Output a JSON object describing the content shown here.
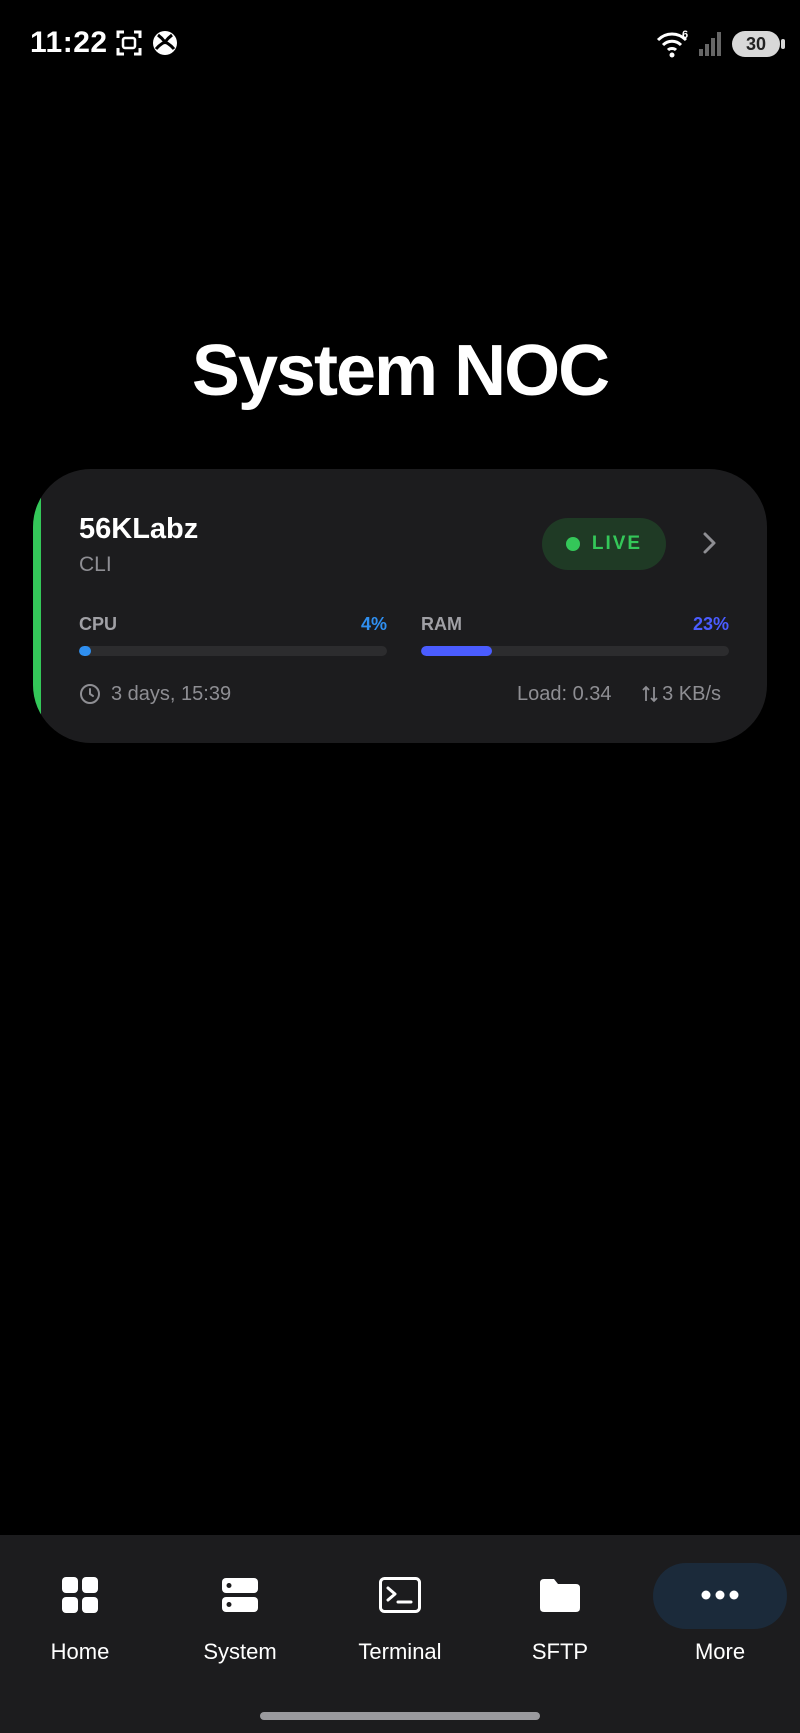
{
  "status_bar": {
    "time": "11:22",
    "wifi_badge": "6",
    "battery": "30",
    "icons": [
      "screenshot-icon",
      "xbox-icon",
      "wifi-icon",
      "signal-icon",
      "battery-icon"
    ]
  },
  "page": {
    "title": "System NOC"
  },
  "server": {
    "name": "56KLabz",
    "type": "CLI",
    "status": "LIVE",
    "status_color": "#34c759",
    "accent_color": "#34c759",
    "cpu": {
      "label": "CPU",
      "value_text": "4%",
      "percent": 4,
      "color": "#2f8ff0"
    },
    "ram": {
      "label": "RAM",
      "value_text": "23%",
      "percent": 23,
      "color": "#4a5cff"
    },
    "uptime": "3 days, 15:39",
    "load": "Load: 0.34",
    "net": "3 KB/s"
  },
  "nav": {
    "items": [
      {
        "label": "Home",
        "icon": "grid-icon"
      },
      {
        "label": "System",
        "icon": "server-icon"
      },
      {
        "label": "Terminal",
        "icon": "terminal-icon"
      },
      {
        "label": "SFTP",
        "icon": "folder-icon"
      },
      {
        "label": "More",
        "icon": "more-dots-icon",
        "active": true
      }
    ]
  }
}
